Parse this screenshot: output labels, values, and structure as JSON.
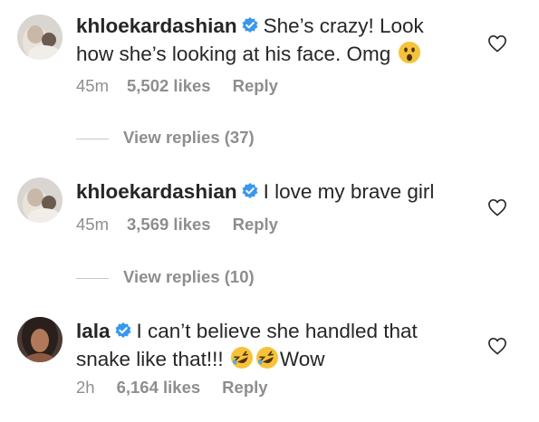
{
  "comments": [
    {
      "username": "khloekardashian",
      "verified": true,
      "text_line1": "She’s crazy! Look",
      "text_line2": "how she’s looking at his face. Omg",
      "emoji": "astonished-face",
      "time": "45m",
      "likes": "5,502 likes",
      "reply": "Reply",
      "view_replies": "View replies (37)"
    },
    {
      "username": "khloekardashian",
      "verified": true,
      "text": "I love my brave girl",
      "time": "45m",
      "likes": "3,569 likes",
      "reply": "Reply",
      "view_replies": "View replies (10)"
    },
    {
      "username": "lala",
      "verified": true,
      "text_line1": "I can’t believe she handled that",
      "text_line2_pre": "snake like that!!!",
      "emojis": [
        "rolling-on-floor-laughing",
        "rolling-on-floor-laughing"
      ],
      "text_line2_post": "Wow",
      "time": "2h",
      "likes": "6,164 likes",
      "reply": "Reply"
    }
  ],
  "colors": {
    "text": "#262626",
    "secondary": "#8e8e8e",
    "verified": "#3897f0",
    "divider": "#c7c7c7"
  },
  "icons": {
    "like": "heart-outline-icon",
    "verified": "verified-badge-icon"
  }
}
